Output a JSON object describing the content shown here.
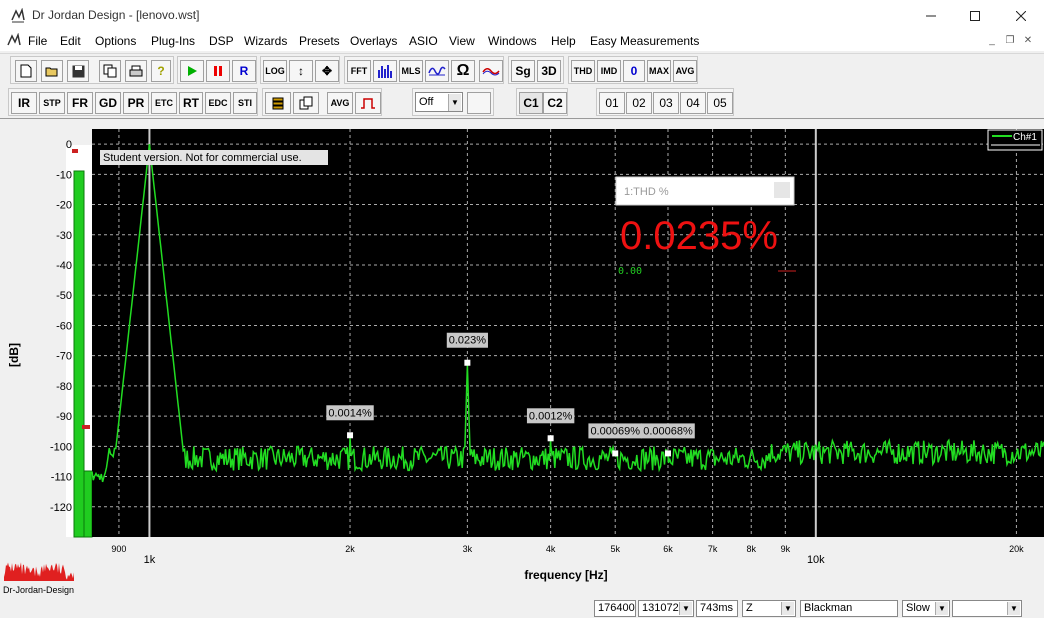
{
  "window": {
    "title": "Dr Jordan Design - [lenovo.wst]"
  },
  "menu": [
    "File",
    "Edit",
    "Options",
    "Plug-Ins",
    "DSP",
    "Wizards",
    "Presets",
    "Overlays",
    "ASIO",
    "View",
    "Windows",
    "Help",
    "Easy Measurements"
  ],
  "toolbar1": {
    "log": "LOG",
    "fft": "FFT",
    "mls": "MLS",
    "omega": "Ω",
    "sg": "Sg",
    "three_d": "3D",
    "thd": "THD",
    "imd": "IMD",
    "zero": "0",
    "max": "MAX",
    "avg": "AVG",
    "record": "R"
  },
  "toolbar2": {
    "buttons": [
      "IR",
      "STP",
      "FR",
      "GD",
      "PR",
      "ETC",
      "RT",
      "EDC",
      "STI"
    ],
    "avg": "AVG",
    "off_select": "Off",
    "c1": "C1",
    "c2": "C2",
    "overlays": [
      "01",
      "02",
      "03",
      "04",
      "05"
    ]
  },
  "plot": {
    "watermark": "Student version. Not for commercial use.",
    "legend": "Ch#1",
    "thd_panel_title": "1:THD %",
    "thd_value": "0.0235%",
    "thd_sub": "0.00",
    "logo_text": "Dr-Jordan-Design"
  },
  "chart_data": {
    "type": "line",
    "xlabel": "frequency [Hz]",
    "ylabel": "[dB]",
    "xscale": "log",
    "xlim": [
      820,
      22000
    ],
    "ylim": [
      -130,
      5
    ],
    "y_ticks": [
      0,
      -10,
      -20,
      -30,
      -40,
      -50,
      -60,
      -70,
      -80,
      -90,
      -100,
      -110,
      -120
    ],
    "x_tick_labels": [
      {
        "value": 900,
        "label": "900"
      },
      {
        "value": 1000,
        "label": "1k"
      },
      {
        "value": 2000,
        "label": "2k"
      },
      {
        "value": 3000,
        "label": "3k"
      },
      {
        "value": 4000,
        "label": "4k"
      },
      {
        "value": 5000,
        "label": "5k"
      },
      {
        "value": 6000,
        "label": "6k"
      },
      {
        "value": 7000,
        "label": "7k"
      },
      {
        "value": 8000,
        "label": "8k"
      },
      {
        "value": 9000,
        "label": "9k"
      },
      {
        "value": 10000,
        "label": "10k"
      },
      {
        "value": 20000,
        "label": "20k"
      }
    ],
    "series": [
      {
        "name": "Ch#1",
        "color": "#22dd22",
        "noise_floor_db": -104,
        "peaks": [
          {
            "x": 1000,
            "y": 0
          },
          {
            "x": 2000,
            "y": -97
          },
          {
            "x": 3000,
            "y": -73
          },
          {
            "x": 4000,
            "y": -98
          },
          {
            "x": 5000,
            "y": -103
          },
          {
            "x": 6000,
            "y": -103
          }
        ]
      }
    ],
    "annotations": [
      {
        "x": 2000,
        "y": -97,
        "text": "0.0014%"
      },
      {
        "x": 3000,
        "y": -73,
        "text": "0.023%"
      },
      {
        "x": 4000,
        "y": -98,
        "text": "0.0012%"
      },
      {
        "x": 5000,
        "y": -103,
        "text": "0.00069%"
      },
      {
        "x": 6000,
        "y": -103,
        "text": "0.00068%"
      }
    ],
    "grid": true,
    "legend_position": "top-right"
  },
  "status": {
    "rate": "176400",
    "fft_size": "131072",
    "time": "743ms",
    "weighting": "Z",
    "window": "Blackman",
    "speed": "Slow",
    "extra": ""
  }
}
